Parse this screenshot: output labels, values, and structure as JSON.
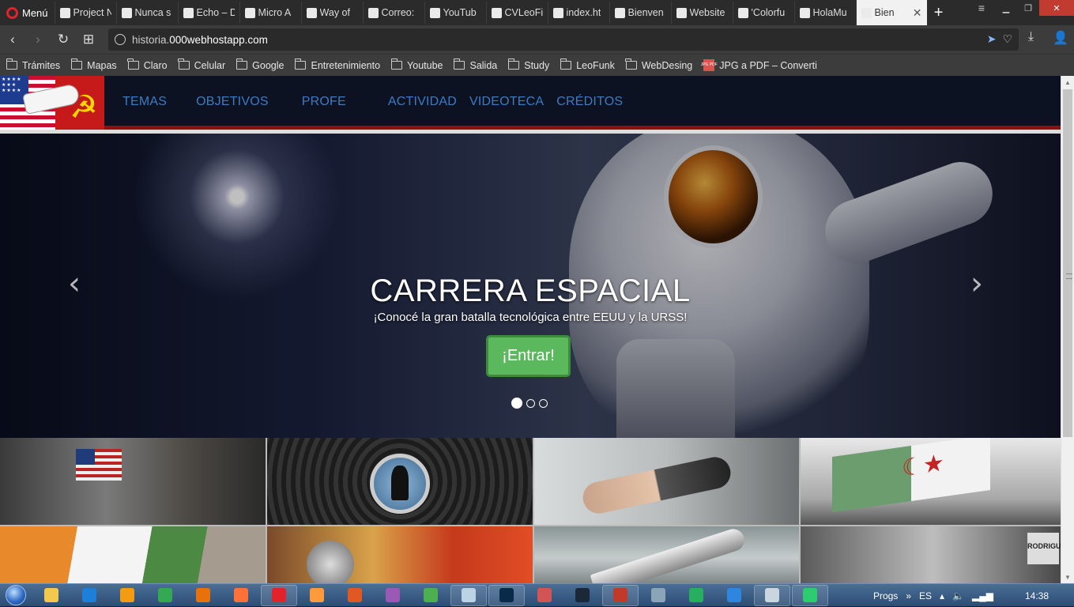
{
  "browser": {
    "menu_label": "Menú",
    "tabs": [
      {
        "title": "Project N",
        "icon": "page-icon"
      },
      {
        "title": "Nunca s",
        "icon": "page-icon"
      },
      {
        "title": "Echo – D",
        "icon": "fgp-icon"
      },
      {
        "title": "Micro A",
        "icon": "fgp-icon"
      },
      {
        "title": "Way of",
        "icon": "app-icon"
      },
      {
        "title": "Correo:",
        "icon": "outlook-icon"
      },
      {
        "title": "YouTub",
        "icon": "youtube-icon"
      },
      {
        "title": "CVLeoFi",
        "icon": "page-icon"
      },
      {
        "title": "index.ht",
        "icon": "search-icon"
      },
      {
        "title": "Bienven",
        "icon": "page-icon"
      },
      {
        "title": "Website",
        "icon": "opera-icon"
      },
      {
        "title": "'Colorfu",
        "icon": "github-icon"
      },
      {
        "title": "HolaMu",
        "icon": "page-icon"
      }
    ],
    "active_tab": {
      "title": "Bien",
      "icon": "page-icon"
    },
    "new_tab_label": "+",
    "url_domain_prefix": "historia.",
    "url_domain": "000webhostapp.com",
    "bookmarks": [
      {
        "label": "Trámites",
        "icon": "folder-icon"
      },
      {
        "label": "Mapas",
        "icon": "folder-icon"
      },
      {
        "label": "Claro",
        "icon": "folder-icon"
      },
      {
        "label": "Celular",
        "icon": "folder-icon"
      },
      {
        "label": "Google",
        "icon": "folder-icon"
      },
      {
        "label": "Entretenimiento",
        "icon": "folder-icon"
      },
      {
        "label": "Youtube",
        "icon": "folder-icon"
      },
      {
        "label": "Salida",
        "icon": "folder-icon"
      },
      {
        "label": "Study",
        "icon": "folder-icon"
      },
      {
        "label": "LeoFunk",
        "icon": "folder-icon"
      },
      {
        "label": "WebDesing",
        "icon": "folder-icon"
      },
      {
        "label": "JPG a PDF – Converti",
        "icon": "jpg-pdf-icon"
      }
    ],
    "jpg_icon_text": "JPG PDF"
  },
  "site": {
    "nav": [
      "TEMAS",
      "OBJETIVOS",
      "PROFE",
      "ACTIVIDAD",
      "VIDEOTECA",
      "CRÉDITOS"
    ],
    "logo_canton_stars": "★★★★ ★★★ ★★★★",
    "logo_symbol": "☭",
    "hero": {
      "title": "CARRERA ESPACIAL",
      "subtitle": "¡Conocé la gran batalla tecnológica entre EEUU y la URSS!",
      "button": "¡Entrar!",
      "slides": 3,
      "active_slide": 1,
      "prev_glyph": "‹",
      "next_glyph": "›"
    },
    "grid_sign_text": "RODRIGU"
  },
  "taskbar": {
    "apps": [
      "explorer",
      "ie",
      "media",
      "chrome",
      "firefox-dev",
      "firefox",
      "opera",
      "app-orange",
      "app-red",
      "app-purple",
      "app-paint",
      "notepad",
      "photoshop",
      "app-flag",
      "steam",
      "filezilla",
      "app-doc",
      "app-green",
      "app-blue",
      "app-img",
      "app-green2"
    ],
    "running": [
      "opera",
      "notepad",
      "photoshop",
      "filezilla",
      "app-img",
      "app-green2"
    ],
    "progs_label": "Progs",
    "lang": "ES",
    "clock": "14:38"
  },
  "colors": {
    "nav_link": "#3a7cc4",
    "nav_bg": "#0c1221",
    "nav_border": "#8b1010",
    "button_green": "#5cb85c"
  }
}
